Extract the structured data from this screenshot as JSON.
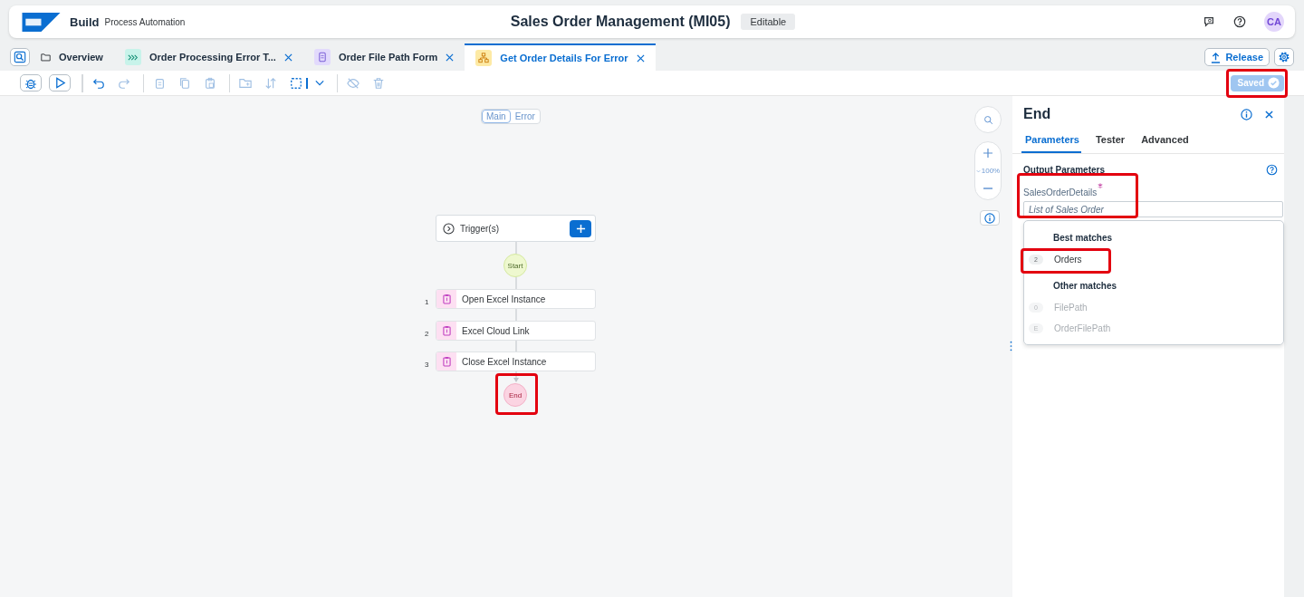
{
  "header": {
    "brand": "Build",
    "product": "Process Automation",
    "title": "Sales Order Management (MI05)",
    "badge": "Editable",
    "avatar": "CA"
  },
  "tabs": [
    {
      "kind": "overview",
      "label": "Overview",
      "selected": false,
      "closable": false
    },
    {
      "kind": "process",
      "label": "Order Processing Error T...",
      "selected": false,
      "closable": true
    },
    {
      "kind": "form",
      "label": "Order File Path Form",
      "selected": false,
      "closable": true
    },
    {
      "kind": "automation",
      "label": "Get Order Details For Error",
      "selected": true,
      "closable": true
    }
  ],
  "release_button": "Release",
  "saved_button": {
    "label": "Saved",
    "highlighted": true
  },
  "canvas": {
    "toggle": [
      {
        "label": "Main",
        "selected": true
      },
      {
        "label": "Error",
        "selected": false
      }
    ],
    "trigger": "Trigger(s)",
    "start": "Start",
    "steps": [
      {
        "number": "1",
        "label": "Open Excel Instance"
      },
      {
        "number": "2",
        "label": "Excel Cloud Link"
      },
      {
        "number": "3",
        "label": "Close Excel Instance"
      }
    ],
    "end": {
      "label": "End",
      "highlighted": true
    },
    "zoom": "100%"
  },
  "panel": {
    "title": "End",
    "tabs": [
      {
        "label": "Parameters",
        "selected": true
      },
      {
        "label": "Tester",
        "selected": false
      },
      {
        "label": "Advanced",
        "selected": false
      }
    ],
    "section": "Output Parameters",
    "field": {
      "label": "SalesOrderDetails",
      "required": true,
      "placeholder": "List of Sales Order",
      "highlighted": true
    },
    "suggestions": [
      {
        "heading": "Best matches",
        "items": [
          {
            "badge": "2",
            "label": "Orders",
            "disabled": false,
            "highlighted": true
          }
        ]
      },
      {
        "heading": "Other matches",
        "items": [
          {
            "badge": "0",
            "label": "FilePath",
            "disabled": true,
            "highlighted": false
          },
          {
            "badge": "E",
            "label": "OrderFilePath",
            "disabled": true,
            "highlighted": false
          }
        ]
      }
    ]
  }
}
